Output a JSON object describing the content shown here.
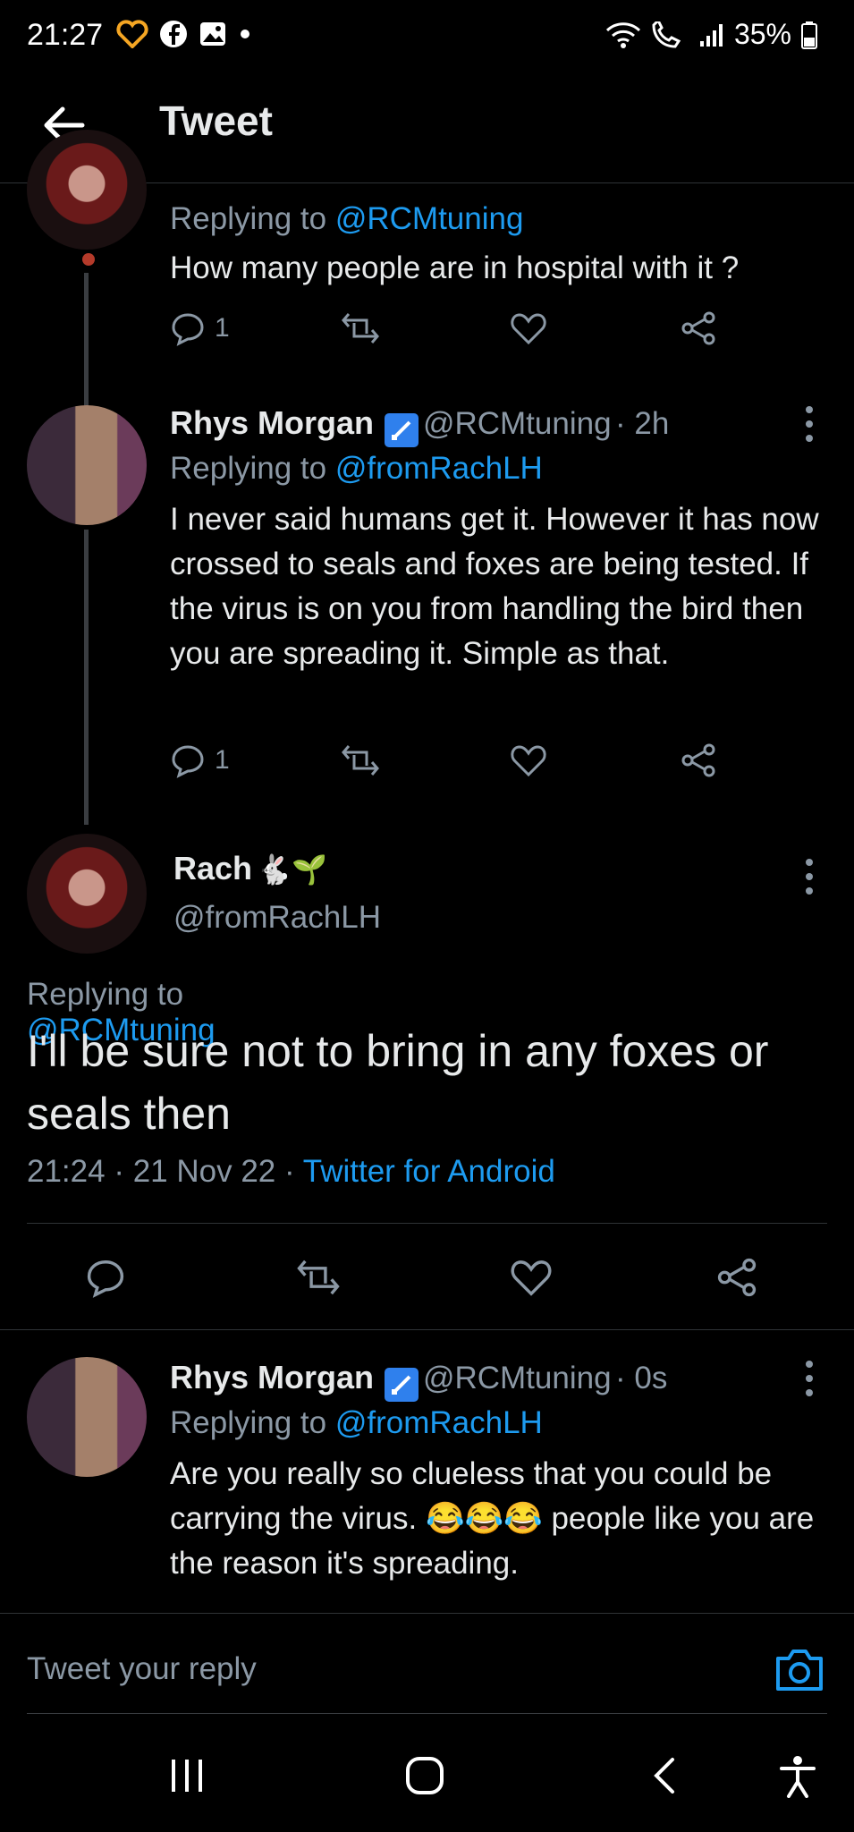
{
  "status_bar": {
    "time": "21:27",
    "battery": "35%"
  },
  "header": {
    "title": "Tweet"
  },
  "tweet_prev": {
    "replying_prefix": "Replying to",
    "replying_to": "@RCMtuning",
    "text": "How many people are in hospital with it ?",
    "reply_count": "1"
  },
  "tweet_rhys1": {
    "name": "Rhys Morgan",
    "handle": "@RCMtuning",
    "time": "· 2h",
    "replying_prefix": "Replying to",
    "replying_to": "@fromRachLH",
    "text": "I never said humans get it. However it has now crossed to seals and foxes are being tested. If the virus is on you from handling the bird then you are spreading it. Simple as that.",
    "reply_count": "1"
  },
  "main_tweet": {
    "name": "Rach",
    "name_emojis": "🐇🌱",
    "handle": "@fromRachLH",
    "replying_prefix": "Replying to",
    "replying_to": "@RCMtuning",
    "text": "I'll be sure not to bring in any foxes or seals then",
    "time": "21:24",
    "date": "21 Nov 22",
    "source": "Twitter for Android",
    "sep": "·"
  },
  "tweet_rhys2": {
    "name": "Rhys Morgan",
    "handle": "@RCMtuning",
    "time": "· 0s",
    "replying_prefix": "Replying to",
    "replying_to": "@fromRachLH",
    "text_part1": "Are you really so clueless that you could be carrying the virus.",
    "emojis": "😂😂😂",
    "text_part2": "people like you are the reason it's spreading."
  },
  "reply_bar": {
    "placeholder": "Tweet your reply"
  },
  "colors": {
    "accent": "#1d9bf0",
    "muted": "#8b98a5",
    "background": "#000000"
  }
}
